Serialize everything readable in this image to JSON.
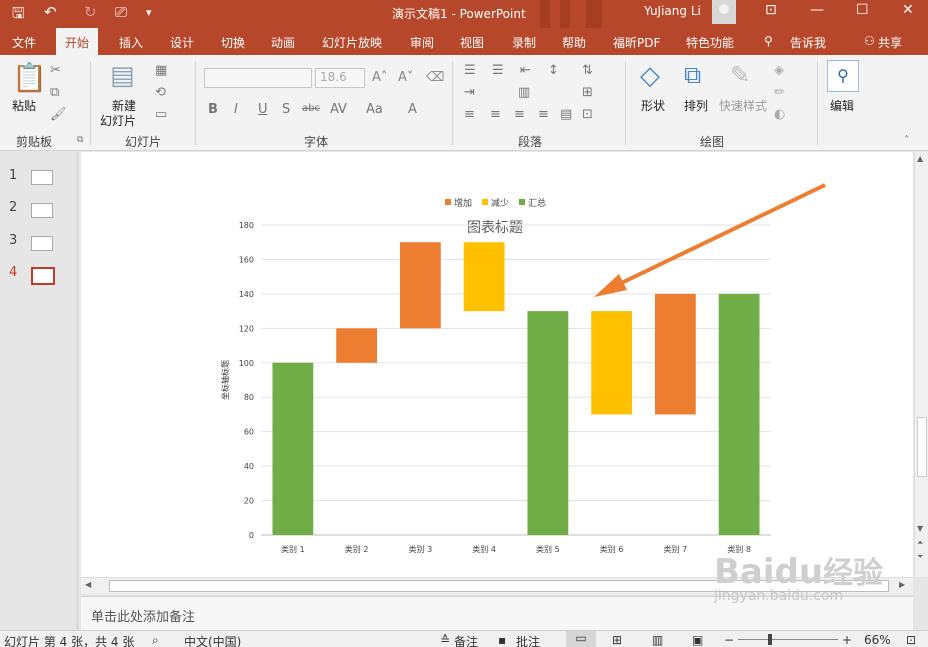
{
  "window": {
    "title": "演示文稿1  -  PowerPoint",
    "user": "YuJiang Li"
  },
  "colors": {
    "accent": "#b7472a",
    "increase": "#ed7d31",
    "decrease": "#ffc000",
    "total": "#70ad47",
    "arrow": "#ed7d31"
  },
  "tabs": [
    "文件",
    "开始",
    "插入",
    "设计",
    "切换",
    "动画",
    "幻灯片放映",
    "审阅",
    "视图",
    "录制",
    "帮助",
    "福昕PDF",
    "特色功能",
    "告诉我",
    "共享"
  ],
  "ribbon": {
    "groups": [
      "剪贴板",
      "幻灯片",
      "字体",
      "段落",
      "绘图"
    ],
    "paste": "粘贴",
    "new_slide": "新建",
    "new_slide2": "幻灯片",
    "font_size": "18.6",
    "shape": "形状",
    "arrange": "排列",
    "quick_style": "快速样式",
    "edit": "编辑"
  },
  "slides": [
    "1",
    "2",
    "3",
    "4"
  ],
  "notes": "单击此处添加备注",
  "status": {
    "slide": "幻灯片 第 4 张，共 4 张",
    "lang": "中文(中国)",
    "notes": "备注",
    "comments": "批注",
    "zoom": "66%"
  },
  "watermark": {
    "brand": "Baidu",
    "cn": "经验",
    "url": "jingyan.baidu.com"
  },
  "chart_data": {
    "type": "bar",
    "title": "图表标题",
    "ylabel": "坐标轴标题",
    "ylim": [
      0,
      180
    ],
    "ytick_step": 20,
    "legend": [
      "增加",
      "减少",
      "汇总"
    ],
    "legend_position": "top",
    "categories": [
      "类别 1",
      "类别 2",
      "类别 3",
      "类别 4",
      "类别 5",
      "类别 6",
      "类别 7",
      "类别 8"
    ],
    "bars": [
      {
        "start": 0,
        "end": 100,
        "kind": "汇总"
      },
      {
        "start": 100,
        "end": 120,
        "kind": "增加"
      },
      {
        "start": 120,
        "end": 170,
        "kind": "增加"
      },
      {
        "start": 130,
        "end": 170,
        "kind": "减少"
      },
      {
        "start": 0,
        "end": 130,
        "kind": "汇总"
      },
      {
        "start": 70,
        "end": 130,
        "kind": "减少"
      },
      {
        "start": 70,
        "end": 140,
        "kind": "增加"
      },
      {
        "start": 0,
        "end": 140,
        "kind": "汇总"
      }
    ]
  }
}
